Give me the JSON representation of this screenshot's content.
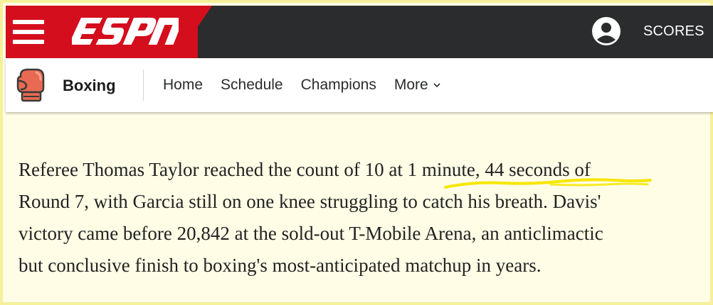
{
  "header": {
    "brand_color": "#d40e1d",
    "bar_color": "#2b2c2d",
    "logo_text": "ESPN",
    "menu_icon": "hamburger-menu-icon",
    "user_icon": "user-account-icon",
    "scores_label": "SCORES"
  },
  "subnav": {
    "sport_icon": "boxing-glove-icon",
    "sport_title": "Boxing",
    "items": [
      {
        "label": "Home"
      },
      {
        "label": "Schedule"
      },
      {
        "label": "Champions"
      },
      {
        "label": "More"
      }
    ],
    "more_icon": "chevron-down-icon"
  },
  "article": {
    "lines": [
      "Referee Thomas Taylor reached the count of 10 at 1 minute, 44 seconds of",
      "Round 7, with Garcia still on one knee struggling to catch his breath. Davis'",
      "victory came before 20,842 at the sold-out T-Mobile Arena, an anticlimactic",
      "but conclusive finish to boxing's most-anticipated matchup in years."
    ],
    "highlight_color": "#f7e600"
  }
}
